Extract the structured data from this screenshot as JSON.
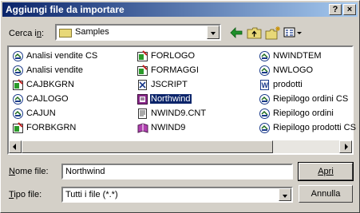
{
  "window": {
    "title": "Aggiungi file da importare",
    "help_label": "?",
    "close_label": "×"
  },
  "lookin": {
    "label": "Cerca in:",
    "value": "Samples"
  },
  "files": [
    {
      "name": "Analisi vendite CS",
      "icon": "report-icon"
    },
    {
      "name": "Analisi vendite",
      "icon": "report-icon"
    },
    {
      "name": "CAJBKGRN",
      "icon": "image-icon"
    },
    {
      "name": "CAJLOGO",
      "icon": "report-icon"
    },
    {
      "name": "CAJUN",
      "icon": "report-icon"
    },
    {
      "name": "FORBKGRN",
      "icon": "image-icon"
    },
    {
      "name": "FORLOGO",
      "icon": "image-icon"
    },
    {
      "name": "FORMAGGI",
      "icon": "image-icon"
    },
    {
      "name": "JSCRIPT",
      "icon": "script-icon"
    },
    {
      "name": "Northwind",
      "icon": "database-icon"
    },
    {
      "name": "NWIND9.CNT",
      "icon": "help-contents-icon"
    },
    {
      "name": "NWIND9",
      "icon": "help-book-icon"
    },
    {
      "name": "NWINDTEM",
      "icon": "report-icon"
    },
    {
      "name": "NWLOGO",
      "icon": "report-icon"
    },
    {
      "name": "prodotti",
      "icon": "word-document-icon"
    },
    {
      "name": "Riepilogo ordini CS",
      "icon": "report-icon"
    },
    {
      "name": "Riepilogo ordini",
      "icon": "report-icon"
    },
    {
      "name": "Riepilogo prodotti CS",
      "icon": "report-icon"
    }
  ],
  "selected_file": "Northwind",
  "filename": {
    "label": "Nome file:",
    "value": "Northwind"
  },
  "filetype": {
    "label": "Tipo file:",
    "value": "Tutti i file (*.*)"
  },
  "buttons": {
    "open": "Apri",
    "cancel": "Annulla"
  }
}
